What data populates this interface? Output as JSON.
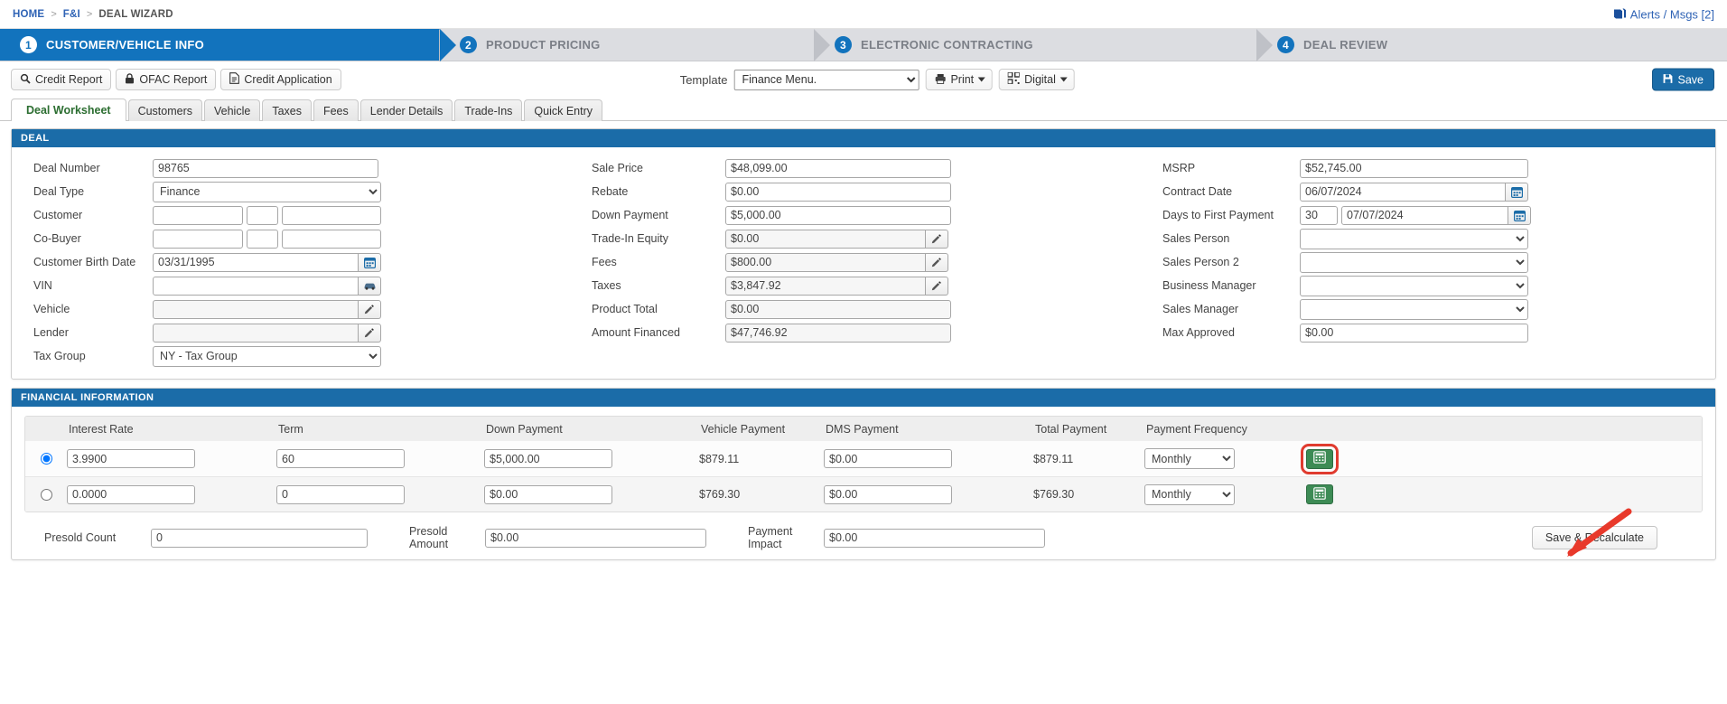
{
  "breadcrumb": {
    "items": [
      "HOME",
      "F&I",
      "DEAL WIZARD"
    ],
    "separator": ">"
  },
  "alerts": {
    "label": "Alerts / Msgs [2]",
    "icon": "book-icon"
  },
  "wizard": {
    "steps": [
      {
        "num": "1",
        "label": "CUSTOMER/VEHICLE INFO",
        "active": true
      },
      {
        "num": "2",
        "label": "PRODUCT PRICING",
        "active": false
      },
      {
        "num": "3",
        "label": "ELECTRONIC CONTRACTING",
        "active": false
      },
      {
        "num": "4",
        "label": "DEAL REVIEW",
        "active": false
      }
    ],
    "active_color": "#1273bd",
    "inactive_color": "#dcdde1"
  },
  "toolbar": {
    "credit_report": "Credit Report",
    "ofac_report": "OFAC Report",
    "credit_application": "Credit Application",
    "template_label": "Template",
    "template_value": "Finance Menu.",
    "print": "Print",
    "digital": "Digital",
    "save": "Save"
  },
  "tabs": [
    {
      "label": "Deal Worksheet",
      "active": true
    },
    {
      "label": "Customers",
      "active": false
    },
    {
      "label": "Vehicle",
      "active": false
    },
    {
      "label": "Taxes",
      "active": false
    },
    {
      "label": "Fees",
      "active": false
    },
    {
      "label": "Lender Details",
      "active": false
    },
    {
      "label": "Trade-Ins",
      "active": false
    },
    {
      "label": "Quick Entry",
      "active": false
    }
  ],
  "deal": {
    "title": "DEAL",
    "left": {
      "deal_number_label": "Deal Number",
      "deal_number_value": "98765",
      "deal_type_label": "Deal Type",
      "deal_type_value": "Finance",
      "customer_label": "Customer",
      "customer_first": "",
      "customer_mi": "",
      "customer_last": "",
      "cobuyer_label": "Co-Buyer",
      "cobuyer_first": "",
      "cobuyer_mi": "",
      "cobuyer_last": "",
      "birth_date_label": "Customer Birth Date",
      "birth_date_value": "03/31/1995",
      "vin_label": "VIN",
      "vin_value": "",
      "vehicle_label": "Vehicle",
      "vehicle_value": "",
      "lender_label": "Lender",
      "lender_value": "",
      "tax_group_label": "Tax Group",
      "tax_group_value": "NY - Tax Group"
    },
    "middle": {
      "sale_price_label": "Sale Price",
      "sale_price_value": "$48,099.00",
      "rebate_label": "Rebate",
      "rebate_value": "$0.00",
      "down_payment_label": "Down Payment",
      "down_payment_value": "$5,000.00",
      "trade_equity_label": "Trade-In Equity",
      "trade_equity_value": "$0.00",
      "fees_label": "Fees",
      "fees_value": "$800.00",
      "taxes_label": "Taxes",
      "taxes_value": "$3,847.92",
      "product_total_label": "Product Total",
      "product_total_value": "$0.00",
      "amount_financed_label": "Amount Financed",
      "amount_financed_value": "$47,746.92"
    },
    "right": {
      "msrp_label": "MSRP",
      "msrp_value": "$52,745.00",
      "contract_date_label": "Contract Date",
      "contract_date_value": "06/07/2024",
      "days_first_payment_label": "Days to First Payment",
      "days_first_payment_value": "30",
      "first_payment_date_value": "07/07/2024",
      "sales_person_label": "Sales Person",
      "sales_person_value": "",
      "sales_person2_label": "Sales Person 2",
      "sales_person2_value": "",
      "business_manager_label": "Business Manager",
      "business_manager_value": "",
      "sales_manager_label": "Sales Manager",
      "sales_manager_value": "",
      "max_approved_label": "Max Approved",
      "max_approved_value": "$0.00"
    }
  },
  "financial": {
    "title": "FINANCIAL INFORMATION",
    "columns": [
      "Interest Rate",
      "Term",
      "Down Payment",
      "Vehicle Payment",
      "DMS Payment",
      "Total Payment",
      "Payment Frequency"
    ],
    "rows": [
      {
        "selected": true,
        "interest_rate": "3.9900",
        "term": "60",
        "down_payment": "$5,000.00",
        "vehicle_payment": "$879.11",
        "dms_payment": "$0.00",
        "total_payment": "$879.11",
        "payment_frequency": "Monthly",
        "highlighted": true
      },
      {
        "selected": false,
        "interest_rate": "0.0000",
        "term": "0",
        "down_payment": "$0.00",
        "vehicle_payment": "$769.30",
        "dms_payment": "$0.00",
        "total_payment": "$769.30",
        "payment_frequency": "Monthly",
        "highlighted": false
      }
    ],
    "footer": {
      "presold_count_label": "Presold Count",
      "presold_count_value": "0",
      "presold_amount_label": "Presold Amount",
      "presold_amount_value": "$0.00",
      "payment_impact_label": "Payment Impact",
      "payment_impact_value": "$0.00",
      "save_recalculate": "Save & Recalculate"
    },
    "calc_button_color": "#3d8b55",
    "annotation_arrow_color": "#e03b2f"
  }
}
